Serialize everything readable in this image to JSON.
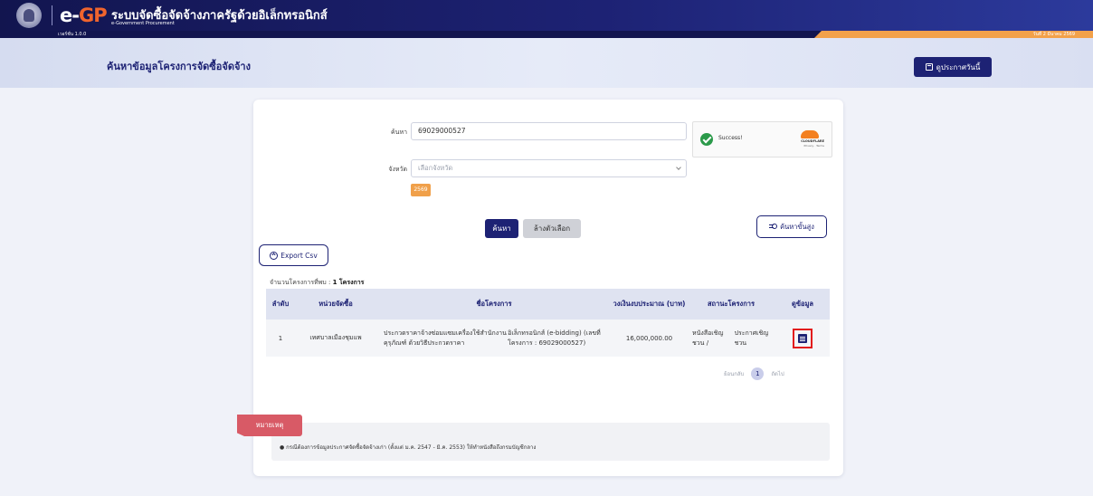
{
  "header": {
    "logo_e": "e-",
    "logo_gp": "GP",
    "site_title": "ระบบจัดซื้อจัดจ้างภาครัฐด้วยอิเล็กทรอนิกส์",
    "site_subtitle": "e-Government Procurement",
    "version": "เวอร์ชั่น 1.0.0",
    "date": "วันที่ 2 มีนาคม 2569"
  },
  "title_bar": {
    "page_title": "ค้นหาข้อมูลโครงการจัดซื้อจัดจ้าง",
    "today_button": "ดูประกาศวันนี้"
  },
  "search_form": {
    "search_label": "ค้นหา",
    "search_value": "69029000527",
    "province_label": "จังหวัด",
    "province_placeholder": "เลือกจังหวัด",
    "year_badge": "2569",
    "search_button": "ค้นหา",
    "clear_button": "ล้างตัวเลือก",
    "advanced_button": "ค้นหาขั้นสูง"
  },
  "captcha": {
    "status": "Success!",
    "brand": "CLOUDFLARE",
    "links": "Privacy · Terms",
    "accent_color": "#f38020"
  },
  "results": {
    "export_button": "Export Csv",
    "count_label": "จำนวนโครงการที่พบ : ",
    "count_value": "1 โครงการ",
    "columns": [
      "ลำดับ",
      "หน่วยจัดซื้อ",
      "ชื่อโครงการ",
      "วงเงินงบประมาณ (บาท)",
      "สถานะโครงการ",
      "ดูข้อมูล"
    ],
    "rows": [
      {
        "no": "1",
        "agency": "เทศบาลเมืองชุมแพ",
        "project_line1": "ประกวดราคาจ้างซ่อมแซมเครื่องใช้สำนักงานคุรุภัณฑ์ ด้วยวิธีประกวดราคา",
        "project_line2": "อิเล็กทรอนิกส์ (e-bidding) (เลขที่โครงการ : 69029000527)",
        "budget": "16,000,000.00",
        "status_line1": "หนังสือเชิญชวน /",
        "status_line2": "ประกาศเชิญชวน"
      }
    ]
  },
  "pagination": {
    "prev": "ย้อนกลับ",
    "current": "1",
    "next": "ถัดไป"
  },
  "note": {
    "tag": "หมายเหตุ",
    "text": "● กรณีต้องการข้อมูลประกาศจัดซื้อจัดจ้างเก่า (ตั้งแต่ ม.ค. 2547 - มิ.ค. 2553) ให้ทำหนังสือถึงกรมบัญชีกลาง"
  },
  "colors": {
    "primary": "#1d2274",
    "accent_orange": "#f0642d",
    "highlight_red": "#e21c1c",
    "note_tag": "#d85a66"
  }
}
